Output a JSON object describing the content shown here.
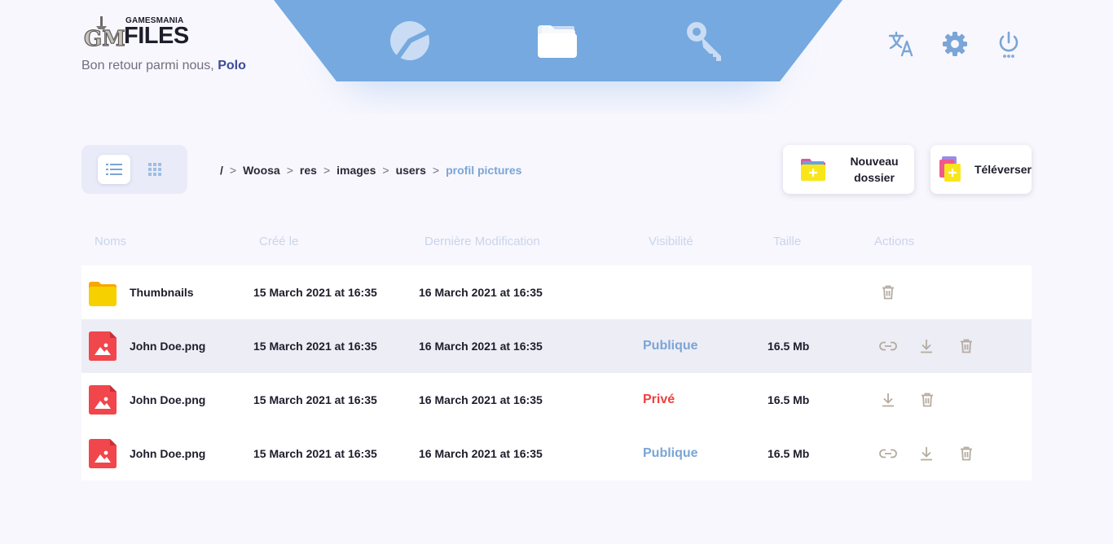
{
  "brand": {
    "small": "GAMESMANIA",
    "big": "FILES",
    "mark": "GM"
  },
  "welcome": {
    "prefix": "Bon retour parmi nous, ",
    "user": "Polo"
  },
  "nav": [
    {
      "name": "nav-dashboard",
      "icon": "pie-chart-icon"
    },
    {
      "name": "nav-files",
      "icon": "folder-icon",
      "active": true
    },
    {
      "name": "nav-keys",
      "icon": "key-icon"
    }
  ],
  "top_actions": [
    {
      "name": "translate-button",
      "icon": "translate-icon"
    },
    {
      "name": "settings-button",
      "icon": "gear-icon"
    },
    {
      "name": "logout-button",
      "icon": "power-icon"
    }
  ],
  "view_modes": [
    "list",
    "grid"
  ],
  "breadcrumb": [
    "/",
    "Woosa",
    "res",
    "images",
    "users",
    "profil pictures"
  ],
  "buttons": {
    "new_folder_line1": "Nouveau",
    "new_folder_line2": "dossier",
    "upload": "Téléverser"
  },
  "columns": {
    "name": "Noms",
    "created": "Créé le",
    "modified": "Dernière Modification",
    "visibility": "Visibilité",
    "size": "Taille",
    "actions": "Actions"
  },
  "rows": [
    {
      "type": "folder",
      "name": "Thumbnails",
      "created": "15 March 2021 at 16:35",
      "modified": "16 March 2021 at 16:35",
      "visibility": "",
      "size": "",
      "actions": [
        "trash"
      ]
    },
    {
      "type": "image",
      "name": "John Doe.png",
      "created": "15 March 2021 at 16:35",
      "modified": "16 March 2021 at 16:35",
      "visibility": "Publique",
      "size": "16.5 Mb",
      "actions": [
        "link",
        "download",
        "trash"
      ]
    },
    {
      "type": "image",
      "name": "John Doe.png",
      "created": "15 March 2021 at 16:35",
      "modified": "16 March 2021 at 16:35",
      "visibility": "Privé",
      "size": "16.5 Mb",
      "actions": [
        "download",
        "trash"
      ]
    },
    {
      "type": "image",
      "name": "John Doe.png",
      "created": "15 March 2021 at 16:35",
      "modified": "16 March 2021 at 16:35",
      "visibility": "Publique",
      "size": "16.5 Mb",
      "actions": [
        "link",
        "download",
        "trash"
      ]
    }
  ],
  "colors": {
    "nav_bg": "#75a9e0",
    "accent": "#7aa5d6",
    "public": "#7aa5d6",
    "private": "#ee4040",
    "folder": "#f7c600",
    "image_file": "#f0464c"
  }
}
